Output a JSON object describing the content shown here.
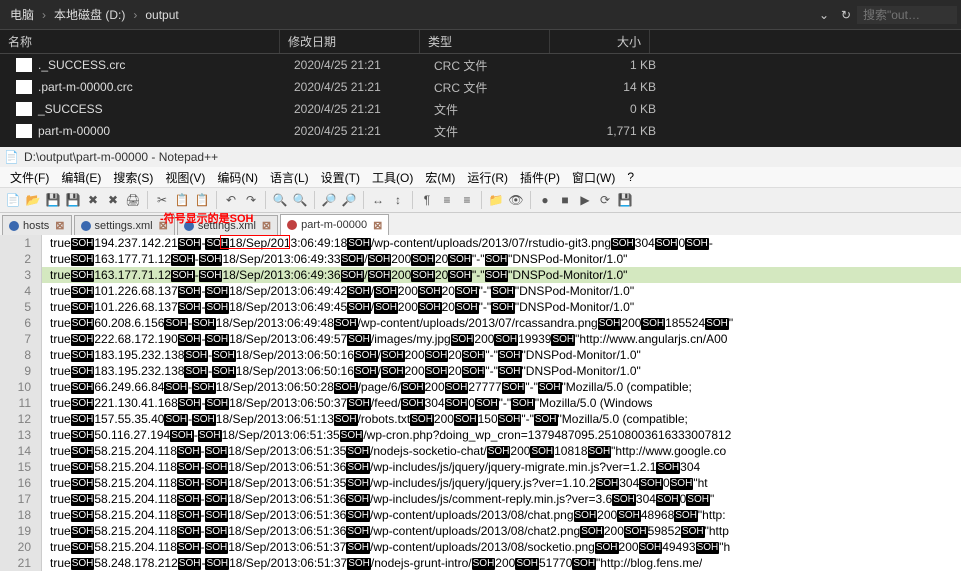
{
  "explorer": {
    "breadcrumb": [
      "电脑",
      "本地磁盘 (D:)",
      "output"
    ],
    "search_placeholder": "搜索\"out…",
    "columns": {
      "name": "名称",
      "date": "修改日期",
      "type": "类型",
      "size": "大小"
    },
    "rows": [
      {
        "name": "._SUCCESS.crc",
        "date": "2020/4/25 21:21",
        "type": "CRC 文件",
        "size": "1 KB"
      },
      {
        "name": ".part-m-00000.crc",
        "date": "2020/4/25 21:21",
        "type": "CRC 文件",
        "size": "14 KB"
      },
      {
        "name": "_SUCCESS",
        "date": "2020/4/25 21:21",
        "type": "文件",
        "size": "0 KB"
      },
      {
        "name": "part-m-00000",
        "date": "2020/4/25 21:21",
        "type": "文件",
        "size": "1,771 KB"
      }
    ]
  },
  "npp": {
    "title": "D:\\output\\part-m-00000 - Notepad++",
    "menu": [
      "文件(F)",
      "编辑(E)",
      "搜索(S)",
      "视图(V)",
      "编码(N)",
      "语言(L)",
      "设置(T)",
      "工具(O)",
      "宏(M)",
      "运行(R)",
      "插件(P)",
      "窗口(W)",
      "?"
    ],
    "annotation": "-符号显示的是SOH",
    "tabs": [
      {
        "label": "hosts",
        "active": false,
        "dirty": false
      },
      {
        "label": "settings.xml",
        "active": false,
        "dirty": false
      },
      {
        "label": "settings.xml",
        "active": false,
        "dirty": false
      },
      {
        "label": "part-m-00000",
        "active": true,
        "dirty": true
      }
    ],
    "lines": [
      {
        "n": 1,
        "seg": [
          "true",
          "SOH",
          "194.237.142.2",
          "1",
          "SOH",
          "-",
          "SOH",
          "1",
          "8/Sep/2013:06:49:18",
          "SOH",
          "/wp-content/uploads/2013/07/rstudio-git3.png",
          "SOH",
          "304",
          "SOH",
          "0",
          "SOH",
          "-"
        ]
      },
      {
        "n": 2,
        "seg": [
          "true",
          "SOH",
          "163.177.71.12",
          "SOH",
          "-",
          "SOH",
          "18/Sep/2013:06:49:33",
          "SOH",
          "/",
          "SOH",
          "200",
          "SOH",
          "20",
          "SOH",
          "\"-\"",
          "SOH",
          "\"DNSPod-Monitor/1.0\""
        ]
      },
      {
        "n": 3,
        "hl": true,
        "seg": [
          "true",
          "SOH",
          "163.177.71.12",
          "SOH",
          "-",
          "SOH",
          "18/Sep/2013:06:49:36",
          "SOH",
          "/",
          "SOH",
          "200",
          "SOH",
          "20",
          "SOH",
          "\"-\"",
          "SOH",
          "\"DNSPod-Monitor/1.0\""
        ]
      },
      {
        "n": 4,
        "seg": [
          "true",
          "SOH",
          "101.226.68.137",
          "SOH",
          "-",
          "SOH",
          "18/Sep/2013:06:49:42",
          "SOH",
          "/",
          "SOH",
          "200",
          "SOH",
          "20",
          "SOH",
          "\"-\"",
          "SOH",
          "\"DNSPod-Monitor/1.0\""
        ]
      },
      {
        "n": 5,
        "seg": [
          "true",
          "SOH",
          "101.226.68.137",
          "SOH",
          "-",
          "SOH",
          "18/Sep/2013:06:49:45",
          "SOH",
          "/",
          "SOH",
          "200",
          "SOH",
          "20",
          "SOH",
          "\"-\"",
          "SOH",
          "\"DNSPod-Monitor/1.0\""
        ]
      },
      {
        "n": 6,
        "seg": [
          "true",
          "SOH",
          "60.208.6.156",
          "SOH",
          "-",
          "SOH",
          "18/Sep/2013:06:49:48",
          "SOH",
          "/wp-content/uploads/2013/07/rcassandra.png",
          "SOH",
          "200",
          "SOH",
          "185524",
          "SOH",
          "\""
        ]
      },
      {
        "n": 7,
        "seg": [
          "true",
          "SOH",
          "222.68.172.190",
          "SOH",
          "-",
          "SOH",
          "18/Sep/2013:06:49:57",
          "SOH",
          "/images/my.jpg",
          "SOH",
          "200",
          "SOH",
          "19939",
          "SOH",
          "\"http://www.angularjs.cn/A00"
        ]
      },
      {
        "n": 8,
        "seg": [
          "true",
          "SOH",
          "183.195.232.138",
          "SOH",
          "-",
          "SOH",
          "18/Sep/2013:06:50:16",
          "SOH",
          "/",
          "SOH",
          "200",
          "SOH",
          "20",
          "SOH",
          "\"-\"",
          "SOH",
          "\"DNSPod-Monitor/1.0\""
        ]
      },
      {
        "n": 9,
        "seg": [
          "true",
          "SOH",
          "183.195.232.138",
          "SOH",
          "-",
          "SOH",
          "18/Sep/2013:06:50:16",
          "SOH",
          "/",
          "SOH",
          "200",
          "SOH",
          "20",
          "SOH",
          "\"-\"",
          "SOH",
          "\"DNSPod-Monitor/1.0\""
        ]
      },
      {
        "n": 10,
        "seg": [
          "true",
          "SOH",
          "66.249.66.84",
          "SOH",
          "-",
          "SOH",
          "18/Sep/2013:06:50:28",
          "SOH",
          "/page/6/",
          "SOH",
          "200",
          "SOH",
          "27777",
          "SOH",
          "\"-\"",
          "SOH",
          "\"Mozilla/5.0 (compatible;"
        ]
      },
      {
        "n": 11,
        "seg": [
          "true",
          "SOH",
          "221.130.41.168",
          "SOH",
          "-",
          "SOH",
          "18/Sep/2013:06:50:37",
          "SOH",
          "/feed/",
          "SOH",
          "304",
          "SOH",
          "0",
          "SOH",
          "\"-\"",
          "SOH",
          "\"Mozilla/5.0 (Windows"
        ]
      },
      {
        "n": 12,
        "seg": [
          "true",
          "SOH",
          "157.55.35.40",
          "SOH",
          "-",
          "SOH",
          "18/Sep/2013:06:51:13",
          "SOH",
          "/robots.txt",
          "SOH",
          "200",
          "SOH",
          "150",
          "SOH",
          "\"-\"",
          "SOH",
          "\"Mozilla/5.0 (compatible;"
        ]
      },
      {
        "n": 13,
        "seg": [
          "true",
          "SOH",
          "50.116.27.194",
          "SOH",
          "-",
          "SOH",
          "18/Sep/2013:06:51:35",
          "SOH",
          "/wp-cron.php?doing_wp_cron=1379487095.25108003616333007812"
        ]
      },
      {
        "n": 14,
        "seg": [
          "true",
          "SOH",
          "58.215.204.118",
          "SOH",
          "-",
          "SOH",
          "18/Sep/2013:06:51:35",
          "SOH",
          "/nodejs-socketio-chat/",
          "SOH",
          "200",
          "SOH",
          "10818",
          "SOH",
          "\"http://www.google.co"
        ]
      },
      {
        "n": 15,
        "seg": [
          "true",
          "SOH",
          "58.215.204.118",
          "SOH",
          "-",
          "SOH",
          "18/Sep/2013:06:51:36",
          "SOH",
          "/wp-includes/js/jquery/jquery-migrate.min.js?ver=1.2.1",
          "SOH",
          "304"
        ]
      },
      {
        "n": 16,
        "seg": [
          "true",
          "SOH",
          "58.215.204.118",
          "SOH",
          "-",
          "SOH",
          "18/Sep/2013:06:51:35",
          "SOH",
          "/wp-includes/js/jquery/jquery.js?ver=1.10.2",
          "SOH",
          "304",
          "SOH",
          "0",
          "SOH",
          "\"ht"
        ]
      },
      {
        "n": 17,
        "seg": [
          "true",
          "SOH",
          "58.215.204.118",
          "SOH",
          "-",
          "SOH",
          "18/Sep/2013:06:51:36",
          "SOH",
          "/wp-includes/js/comment-reply.min.js?ver=3.6",
          "SOH",
          "304",
          "SOH",
          "0",
          "SOH",
          "\""
        ]
      },
      {
        "n": 18,
        "seg": [
          "true",
          "SOH",
          "58.215.204.118",
          "SOH",
          "-",
          "SOH",
          "18/Sep/2013:06:51:36",
          "SOH",
          "/wp-content/uploads/2013/08/chat.png",
          "SOH",
          "200",
          "SOH",
          "48968",
          "SOH",
          "\"http:"
        ]
      },
      {
        "n": 19,
        "seg": [
          "true",
          "SOH",
          "58.215.204.118",
          "SOH",
          "-",
          "SOH",
          "18/Sep/2013:06:51:36",
          "SOH",
          "/wp-content/uploads/2013/08/chat2.png",
          "SOH",
          "200",
          "SOH",
          "59852",
          "SOH",
          "\"http"
        ]
      },
      {
        "n": 20,
        "seg": [
          "true",
          "SOH",
          "58.215.204.118",
          "SOH",
          "-",
          "SOH",
          "18/Sep/2013:06:51:37",
          "SOH",
          "/wp-content/uploads/2013/08/socketio.png",
          "SOH",
          "200",
          "SOH",
          "49493",
          "SOH",
          "\"h"
        ]
      },
      {
        "n": 21,
        "seg": [
          "true",
          "SOH",
          "58.248.178.212",
          "SOH",
          "-",
          "SOH",
          "18/Sep/2013:06:51:37",
          "SOH",
          "/nodejs-grunt-intro/",
          "SOH",
          "200",
          "SOH",
          "51770",
          "SOH",
          "\"http://blog.fens.me/"
        ]
      }
    ]
  }
}
